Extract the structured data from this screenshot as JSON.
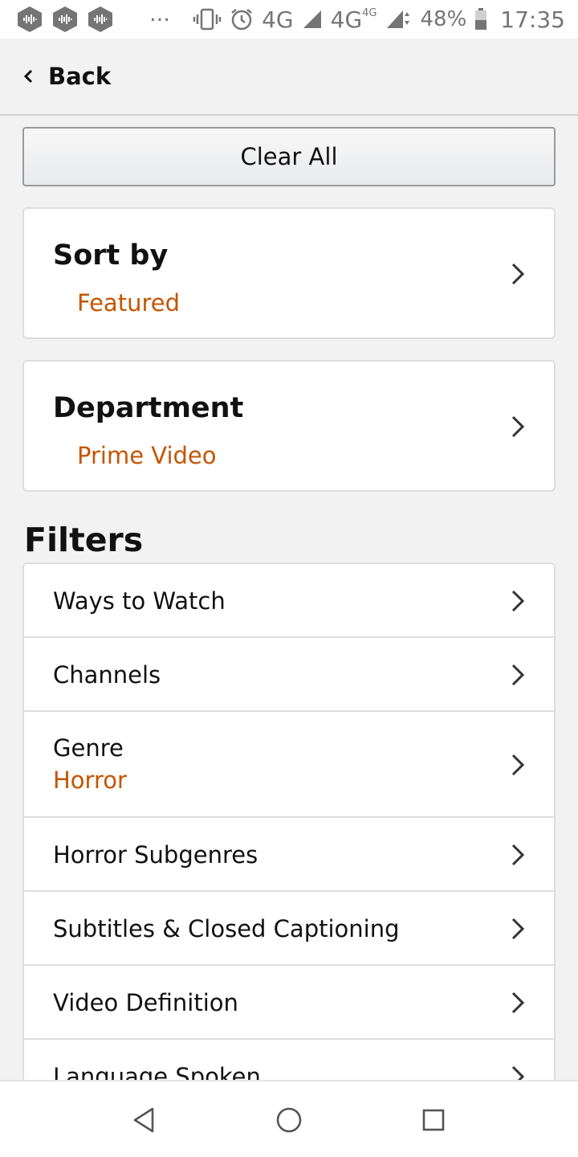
{
  "status_bar": {
    "app_icons": [
      "podcast-app-icon",
      "podcast-app-icon",
      "podcast-app-icon"
    ],
    "more": "…",
    "network_1": "4G",
    "network_2": "4G",
    "network_2_sup": "4G",
    "battery": "48%",
    "time": "17:35"
  },
  "header": {
    "back_label": "Back"
  },
  "clear_all_label": "Clear All",
  "sort": {
    "title": "Sort by",
    "value": "Featured"
  },
  "department": {
    "title": "Department",
    "value": "Prime Video"
  },
  "filters": {
    "title": "Filters",
    "items": [
      {
        "label": "Ways to Watch"
      },
      {
        "label": "Channels"
      },
      {
        "label": "Genre",
        "value": "Horror"
      },
      {
        "label": "Horror Subgenres"
      },
      {
        "label": "Subtitles & Closed Captioning"
      },
      {
        "label": "Video Definition"
      },
      {
        "label": "Language Spoken"
      }
    ]
  },
  "colors": {
    "accent": "#c45500",
    "text": "#111111",
    "background": "#f2f2f2"
  }
}
